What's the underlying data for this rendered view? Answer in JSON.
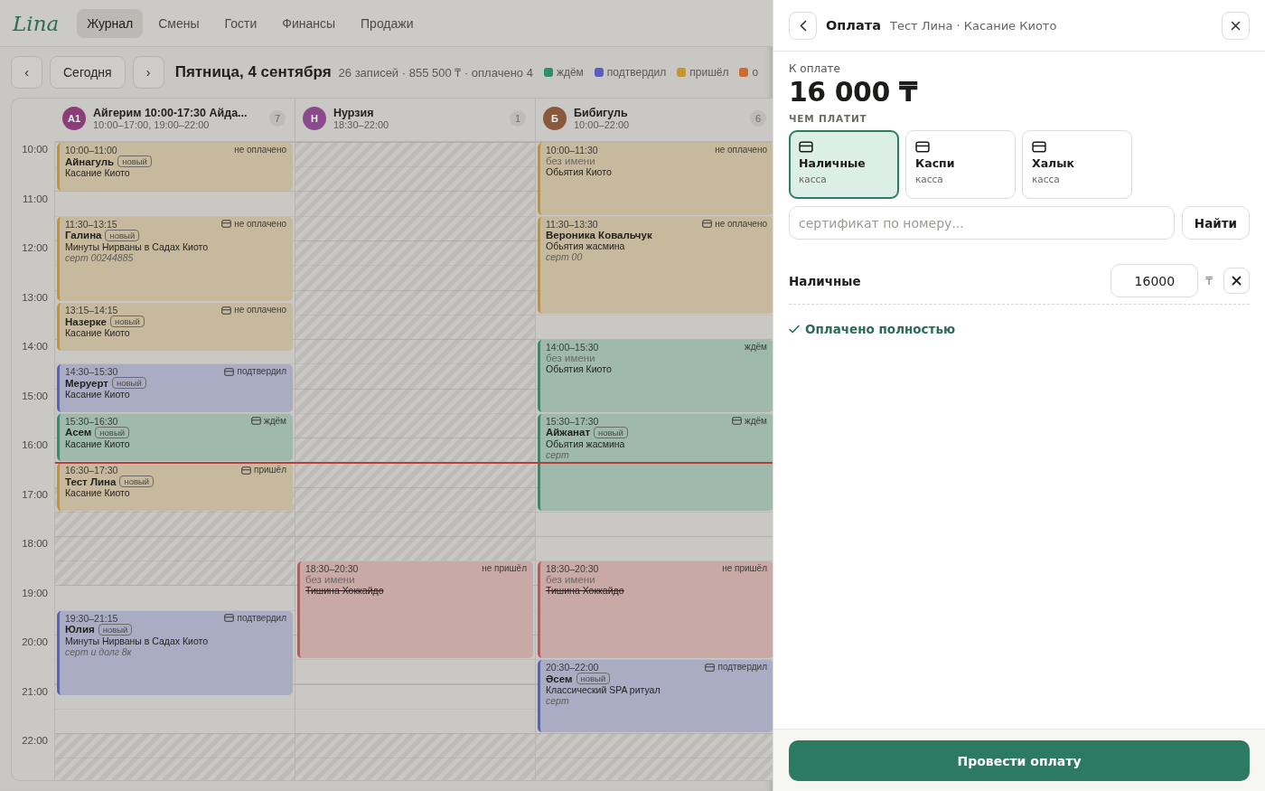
{
  "nav": {
    "logo": "Lina",
    "tabs": [
      {
        "label": "Журнал",
        "selected": true
      },
      {
        "label": "Смены",
        "selected": false
      },
      {
        "label": "Гости",
        "selected": false
      },
      {
        "label": "Финансы",
        "selected": false
      },
      {
        "label": "Продажи",
        "selected": false
      }
    ]
  },
  "toolbar": {
    "prev": "‹",
    "today": "Сегодня",
    "next": "›",
    "date": "Пятница, 4 сентября",
    "summary": "26 записей · 855 500 ₸ · оплачено 4",
    "legend": [
      {
        "label": "ждём",
        "color": "#2f8c6e"
      },
      {
        "label": "подтвердил",
        "color": "#5a5ec4"
      },
      {
        "label": "пришёл",
        "color": "#c8952c"
      },
      {
        "label": "о",
        "color": "#cf6a2c"
      }
    ]
  },
  "calendar": {
    "hours": [
      "10:00",
      "11:00",
      "12:00",
      "13:00",
      "14:00",
      "15:00",
      "16:00",
      "17:00",
      "18:00",
      "19:00",
      "20:00",
      "21:00",
      "22:00"
    ],
    "now_line": {
      "level": 0.5
    },
    "columns": [
      {
        "initials": "А1",
        "color": "#8b3d7a",
        "name": "Айгерим 10:00-17:30 Айда...",
        "hours": "10:00–17:00, 19:00–22:00",
        "count": "7",
        "events": [
          {
            "time": "10:00–11:00",
            "status": "не оплачено",
            "card": false,
            "name": "Айнагуль",
            "anonymous": false,
            "badge": "новый",
            "service": "Касание Киото",
            "cancelled": false,
            "color": "#c39232"
          },
          {
            "time": "11:30–13:15",
            "status": "не оплачено",
            "card": true,
            "name": "Галина",
            "anonymous": false,
            "badge": "новый",
            "service": "Минуты Нирваны в Садах Киото",
            "note": "серт 00244885",
            "cancelled": false,
            "color": "#c39232"
          },
          {
            "time": "13:15–14:15",
            "status": "не оплачено",
            "card": true,
            "name": "Назерке",
            "anonymous": false,
            "badge": "новый",
            "service": "Касание Киото",
            "cancelled": false,
            "color": "#c39232"
          },
          {
            "time": "14:30–15:30",
            "status": "подтвердил",
            "card": true,
            "name": "Меруерт",
            "anonymous": false,
            "badge": "новый",
            "service": "Касание Киото",
            "cancelled": false,
            "color": "#5560c0"
          },
          {
            "time": "15:30–16:30",
            "status": "ждём",
            "card": true,
            "name": "Асем",
            "anonymous": false,
            "badge": "новый",
            "service": "Касание Киото",
            "cancelled": false,
            "color": "#2e8f6f"
          },
          {
            "time": "16:30–17:30",
            "status": "пришёл",
            "card": true,
            "name": "Тест Лина",
            "anonymous": false,
            "badge": "новый",
            "service": "Касание Киото",
            "cancelled": false,
            "color": "#c39232"
          },
          {
            "time": "19:30–21:15",
            "status": "подтвердил",
            "card": true,
            "name": "Юлия",
            "anonymous": false,
            "badge": "новый",
            "service": "Минуты Нирваны в Садах Киото",
            "note": "серт и долг 8к",
            "cancelled": false,
            "color": "#5560c0"
          }
        ]
      },
      {
        "initials": "Н",
        "color": "#8b4a8c",
        "name": "Нурзия",
        "hours": "18:30–22:00",
        "count": "1",
        "events": [
          {
            "time": "18:30–20:30",
            "status": "не пришёл",
            "card": false,
            "name": "без имени",
            "anonymous": true,
            "service": "Тишина Хоккайдо",
            "cancelled": true,
            "color": "#c55555"
          }
        ]
      },
      {
        "initials": "Б",
        "color": "#8a583c",
        "name": "Бибигуль",
        "hours": "10:00–22:00",
        "count": "6",
        "events": [
          {
            "time": "10:00–11:30",
            "status": "не оплачено",
            "card": false,
            "name": "без имени",
            "anonymous": true,
            "service": "Обьятия Киото",
            "cancelled": false,
            "color": "#c39232"
          },
          {
            "time": "11:30–13:30",
            "status": "не оплачено",
            "card": true,
            "name": "Вероника Ковальчук",
            "anonymous": false,
            "service": "Обьятия жасмина",
            "note": "серт 00",
            "cancelled": false,
            "color": "#c39232"
          },
          {
            "time": "14:00–15:30",
            "status": "ждём",
            "card": false,
            "name": "без имени",
            "anonymous": true,
            "service": "Обьятия Киото",
            "cancelled": false,
            "color": "#2e8f6f"
          },
          {
            "time": "15:30–17:30",
            "status": "ждём",
            "card": true,
            "name": "Айжанат",
            "anonymous": false,
            "badge": "новый",
            "service": "Обьятия жасмина",
            "note": "серт",
            "cancelled": false,
            "color": "#2e8f6f"
          },
          {
            "time": "18:30–20:30",
            "status": "не пришёл",
            "card": false,
            "name": "без имени",
            "anonymous": true,
            "service": "Тишина Хоккайдо",
            "cancelled": true,
            "color": "#c55555"
          },
          {
            "time": "20:30–22:00",
            "status": "подтвердил",
            "card": true,
            "name": "Әсем",
            "anonymous": false,
            "badge": "новый",
            "service": "Классический SPA ритуал",
            "note": "серт",
            "cancelled": false,
            "color": "#5560c0"
          }
        ]
      }
    ]
  },
  "payment": {
    "title": "Оплата",
    "subtitle": "Тест Лина · Касание Киото",
    "amount_label": "К оплате",
    "amount": "16 000 ₸",
    "methods_label": "ЧЕМ ПЛАТИТ",
    "methods": [
      {
        "name": "Наличные",
        "sub": "касса",
        "selected": true
      },
      {
        "name": "Каспи",
        "sub": "касса",
        "selected": false
      },
      {
        "name": "Халык",
        "sub": "касса",
        "selected": false
      }
    ],
    "certificate": {
      "placeholder": "сертификат по номеру...",
      "button": "Найти"
    },
    "lines": [
      {
        "method": "Наличные",
        "value": "16000",
        "currency": "₸"
      }
    ],
    "status": "Оплачено полностью",
    "submit": "Провести оплату"
  }
}
